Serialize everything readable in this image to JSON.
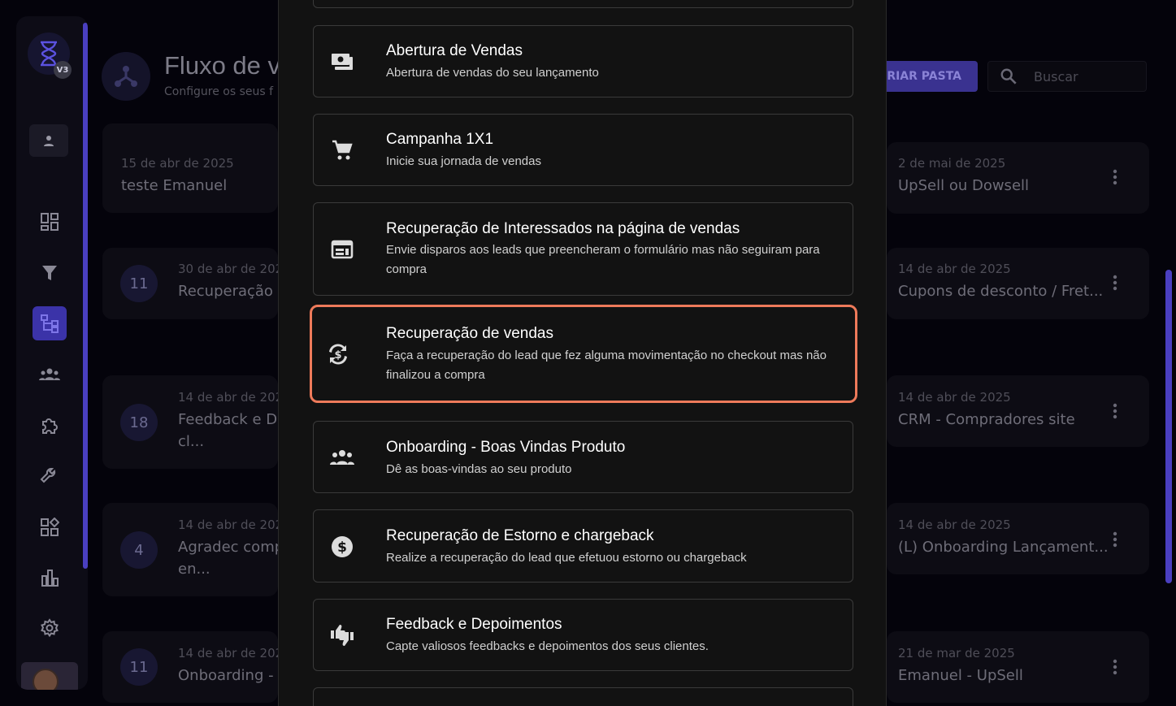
{
  "sidebar": {
    "logo_badge": "V3",
    "nav_icons": [
      "dashboard-icon",
      "funnel-icon",
      "flow-icon",
      "users-icon",
      "puzzle-icon",
      "wrench-icon",
      "apps-icon",
      "chart-icon",
      "gear-icon"
    ],
    "active_index": 2
  },
  "header": {
    "title": "Fluxo de v",
    "subtitle": "Configure os seus f",
    "create_label": "CRIAR PASTA",
    "search_placeholder": "Buscar"
  },
  "flows_left": [
    {
      "count": "",
      "date": "15 de abr de 2025",
      "name": "teste Emanuel",
      "name2": ""
    },
    {
      "count": "11",
      "date": "30 de abr de 202",
      "name": "Recuperação d",
      "name2": ""
    },
    {
      "count": "18",
      "date": "14 de abr de 202",
      "name": "Feedback e De",
      "name2": "cl..."
    },
    {
      "count": "4",
      "date": "14 de abr de 202",
      "name": "Agradec comp",
      "name2": "en..."
    },
    {
      "count": "11",
      "date": "14 de abr de 202",
      "name": "Onboarding - E",
      "name2": ""
    }
  ],
  "flows_right": [
    {
      "date": "2 de mai de 2025",
      "name": "UpSell ou Dowsell"
    },
    {
      "date": "14 de abr de 2025",
      "name": "Cupons de desconto / Fret..."
    },
    {
      "date": "14 de abr de 2025",
      "name": "CRM - Compradores site"
    },
    {
      "date": "14 de abr de 2025",
      "name": "(L) Onboarding Lançament..."
    },
    {
      "date": "21 de mar de 2025",
      "name": "Emanuel - UpSell"
    }
  ],
  "templates": [
    {
      "icon": "payments-icon",
      "title": "Abertura de Vendas",
      "desc": "Abertura de vendas do seu lançamento",
      "selected": false
    },
    {
      "icon": "cart-icon",
      "title": "Campanha 1X1",
      "desc": "Inicie sua jornada de vendas",
      "selected": false
    },
    {
      "icon": "form-icon",
      "title": "Recuperação de Interessados na página de vendas",
      "desc": "Envie disparos aos leads que preencheram o formulário mas não seguiram para compra",
      "selected": false
    },
    {
      "icon": "currency-refresh-icon",
      "title": "Recuperação de vendas",
      "desc": "Faça a recuperação do lead que fez alguma movimentação no checkout mas não finalizou a compra",
      "selected": true
    },
    {
      "icon": "group-icon",
      "title": "Onboarding - Boas Vindas Produto",
      "desc": "Dê as boas-vindas ao seu produto",
      "selected": false
    },
    {
      "icon": "dollar-circle-icon",
      "title": "Recuperação de Estorno e chargeback",
      "desc": "Realize a recuperação do lead que efetuou estorno ou chargeback",
      "selected": false
    },
    {
      "icon": "thumbs-icon",
      "title": "Feedback e Depoimentos",
      "desc": "Capte valiosos feedbacks e depoimentos dos seus clientes.",
      "selected": false
    }
  ],
  "colors": {
    "accent": "#3b33a8",
    "selected_border": "#ee7a5a",
    "modal_bg": "#121212"
  }
}
